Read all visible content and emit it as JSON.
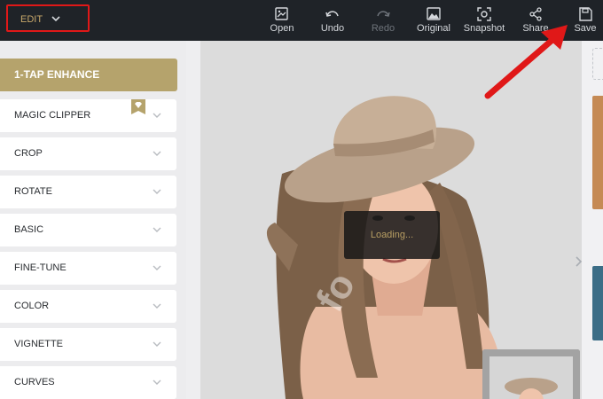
{
  "menu": {
    "edit_label": "EDIT"
  },
  "toolbar": {
    "open": "Open",
    "undo": "Undo",
    "redo": "Redo",
    "original": "Original",
    "snapshot": "Snapshot",
    "share": "Share",
    "save": "Save"
  },
  "sidebar": {
    "enhance": "1-TAP ENHANCE",
    "items": [
      "MAGIC CLIPPER",
      "CROP",
      "ROTATE",
      "BASIC",
      "FINE-TUNE",
      "COLOR",
      "VIGNETTE",
      "CURVES"
    ]
  },
  "canvas": {
    "loading_text": "Loading...",
    "watermark": "fo"
  },
  "colors": {
    "topbar": "#1f2328",
    "accent_gold": "#b5a36c",
    "highlight_red": "#e01818"
  },
  "icons": [
    "chevron-down-icon",
    "open-icon",
    "undo-icon",
    "redo-icon",
    "original-icon",
    "snapshot-icon",
    "share-icon",
    "save-icon",
    "diamond-icon",
    "chevron-right-icon",
    "arrow-annotation-icon"
  ]
}
